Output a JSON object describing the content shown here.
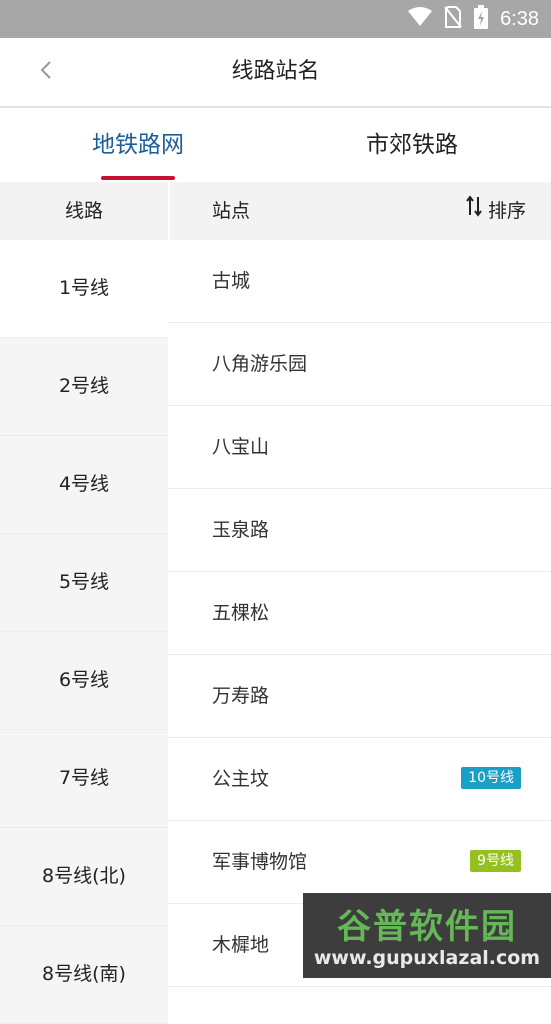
{
  "status_bar": {
    "time": "6:38",
    "icons": [
      "wifi-icon",
      "no-sim-icon",
      "battery-charging-icon"
    ]
  },
  "header": {
    "title": "线路站名",
    "back_icon": "chevron-left-icon"
  },
  "tabs": [
    {
      "label": "地铁路网",
      "active": true
    },
    {
      "label": "市郊铁路",
      "active": false
    }
  ],
  "accent": {
    "tab_active": "#1c5e9a",
    "indicator": "#c8102e"
  },
  "columns": {
    "lines_header": "线路",
    "stations_header": "站点",
    "sort_label": "排序",
    "sort_icon": "sort-arrows-icon"
  },
  "lines": [
    "1号线",
    "2号线",
    "4号线",
    "5号线",
    "6号线",
    "7号线",
    "8号线(北)",
    "8号线(南)"
  ],
  "stations": [
    {
      "name": "古城"
    },
    {
      "name": "八角游乐园"
    },
    {
      "name": "八宝山"
    },
    {
      "name": "玉泉路"
    },
    {
      "name": "五棵松"
    },
    {
      "name": "万寿路"
    },
    {
      "name": "公主坟",
      "transfer": "10号线",
      "color": "#1a9fc6"
    },
    {
      "name": "军事博物馆",
      "transfer": "9号线",
      "color": "#95c11f"
    },
    {
      "name": "木樨地"
    }
  ],
  "watermark": {
    "title": "谷普软件园",
    "url": "www.gupuxlazal.com"
  }
}
